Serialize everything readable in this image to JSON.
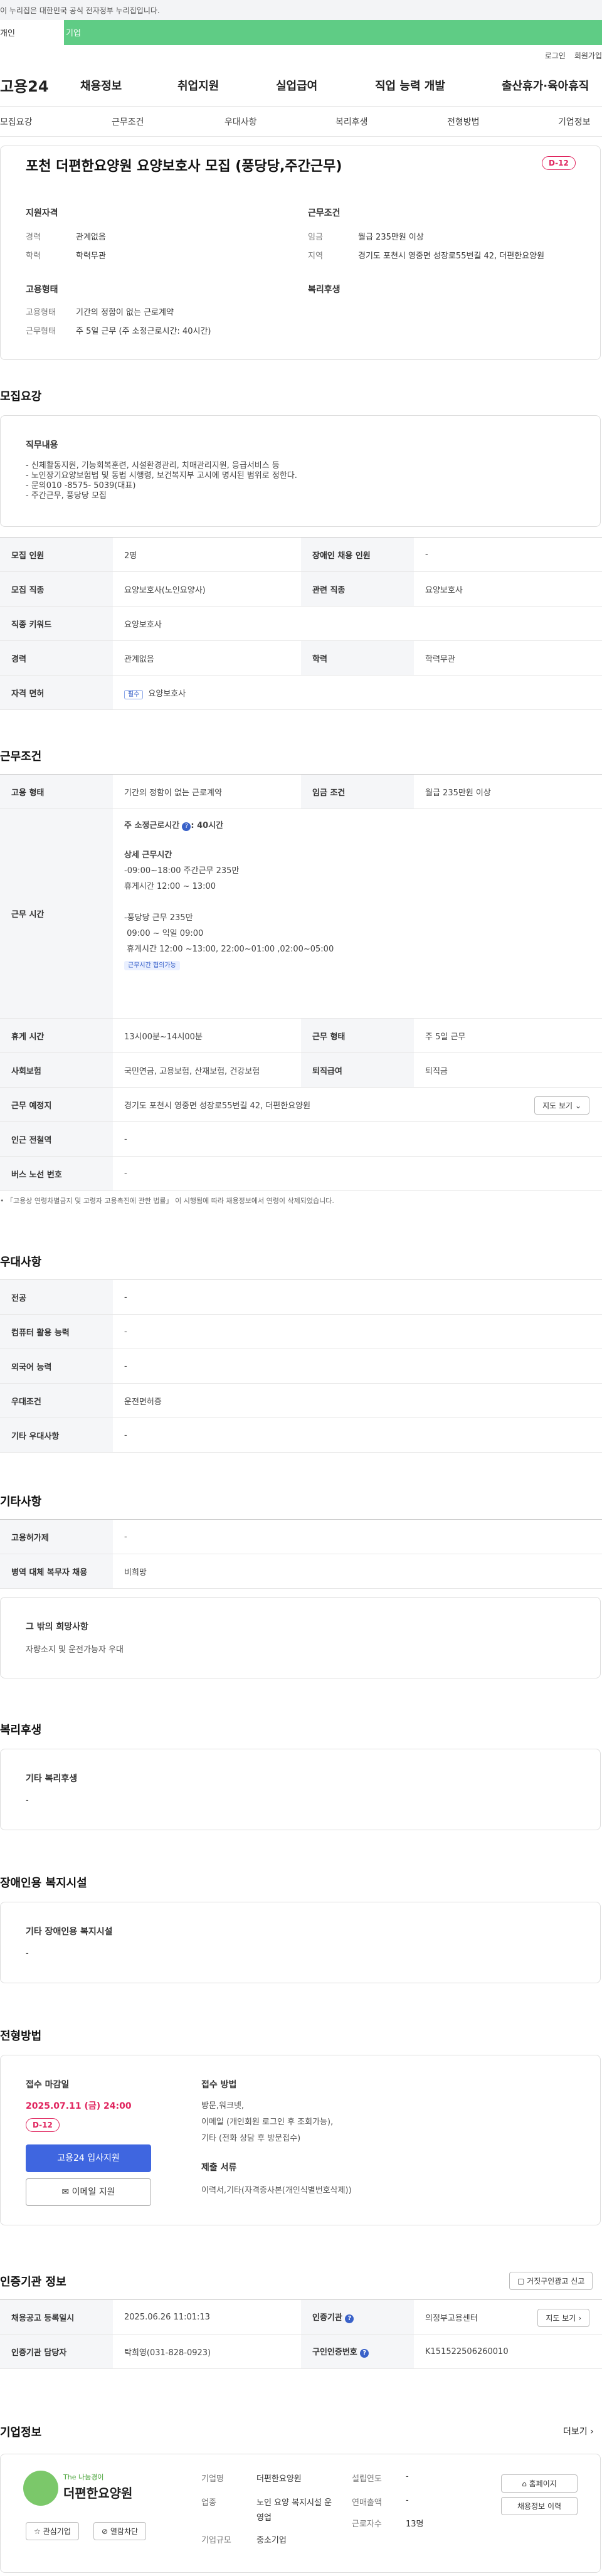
{
  "gov_bar": "이 누리집은 대한민국 공식 전자정부 누리집입니다.",
  "top_tabs": [
    "개인",
    "기업"
  ],
  "util_links": [
    "로그인",
    "회원가입"
  ],
  "logo": "고용24",
  "gnb": [
    "채용정보",
    "취업지원",
    "실업급여",
    "직업 능력 개발",
    "출산휴가·육아휴직"
  ],
  "anchor_tabs": [
    "모집요강",
    "근무조건",
    "우대사항",
    "복리후생",
    "전형방법",
    "기업정보"
  ],
  "job": {
    "title": "포천 더편한요양원 요양보호사 모집 (풍당당,주간근무)",
    "dday": "D-12",
    "summary": {
      "qual_title": "지원자격",
      "qual": [
        {
          "k": "경력",
          "v": "관계없음"
        },
        {
          "k": "학력",
          "v": "학력무관"
        }
      ],
      "cond_title": "근무조건",
      "cond": [
        {
          "k": "임금",
          "v": "월급 235만원 이상"
        },
        {
          "k": "지역",
          "v": "경기도 포천시 영중면 성장로55번길 42, 더편한요양원"
        }
      ],
      "type_title": "고용형태",
      "type": [
        {
          "k": "고용형태",
          "v": "기간의 정함이 없는 근로계약"
        },
        {
          "k": "근무형태",
          "v": "주 5일 근무 (주 소정근로시간: 40시간)"
        }
      ],
      "welfare_title": "복리후생"
    }
  },
  "recruit": {
    "title": "모집요강",
    "duty_title": "직무내용",
    "duty_lines": [
      "- 신체활동지원, 기능회복훈련, 시설환경관리, 치매관리지원, 응급서비스 등",
      "- 노인장기요양보험법 및 동법 시행령, 보건복지부 고시에 명시된 범위로 정한다.",
      "- 문의010 -8575- 5039(대표)",
      "- 주간근무, 풍당당 모집"
    ],
    "rows": [
      {
        "k1": "모집 인원",
        "v1": "2명",
        "k2": "장애인 채용 인원",
        "v2": "-"
      },
      {
        "k1": "모집 직종",
        "v1": "요양보호사(노인요양사)",
        "k2": "관련 직종",
        "v2": "요양보호사"
      },
      {
        "k1": "직종 키워드",
        "v1": "요양보호사"
      },
      {
        "k1": "경력",
        "v1": "관계없음",
        "k2": "학력",
        "v2": "학력무관"
      },
      {
        "k1": "자격 면허",
        "tag": "필수",
        "v1": "요양보호사"
      }
    ]
  },
  "work": {
    "title": "근무조건",
    "emp_type_k": "고용 형태",
    "emp_type_v": "기간의 정함이 없는 근로계약",
    "wage_k": "임금 조건",
    "wage_v": "월급 235만원 이상",
    "hours_k": "근무 시간",
    "hours_main": "주 소정근로시간",
    "hours_value": ": 40시간",
    "hours_detail_title": "상세 근무시간",
    "hours_lines": [
      "-09:00~18:00  주간근무 235만",
      "휴게시간 12:00 ~ 13:00",
      "",
      "-풍당당 근무 235만",
      " 09:00 ~ 익일 09:00",
      " 휴게시간 12:00 ~13:00, 22:00~01:00 ,02:00~05:00"
    ],
    "hours_tag": "근무시간 협의가능",
    "rest_k": "휴게 시간",
    "rest_v": "13시00분~14시00분",
    "form_k": "근무 형태",
    "form_v": "주 5일 근무",
    "ins_k": "사회보험",
    "ins_v": "국민연금, 고용보험, 산재보험, 건강보험",
    "sev_k": "퇴직급여",
    "sev_v": "퇴직금",
    "place_k": "근무 예정지",
    "place_v": "경기도 포천시 영중면 성장로55번길 42, 더편한요양원",
    "map_btn": "지도 보기",
    "subway_k": "인근 전철역",
    "subway_v": "-",
    "bus_k": "버스 노선 번호",
    "bus_v": "-",
    "note": "「고용상 연령차별금지 및 고령자 고용촉진에 관한 법률」 이 시행됨에 따라 채용정보에서 연령이 삭제되었습니다."
  },
  "pref": {
    "title": "우대사항",
    "rows": [
      {
        "k": "전공",
        "v": "-"
      },
      {
        "k": "컴퓨터 활용 능력",
        "v": "-"
      },
      {
        "k": "외국어 능력",
        "v": "-"
      },
      {
        "k": "우대조건",
        "v": "운전면허증"
      },
      {
        "k": "기타 우대사항",
        "v": "-"
      }
    ]
  },
  "other": {
    "title": "기타사항",
    "rows": [
      {
        "k": "고용허가제",
        "v": "-"
      },
      {
        "k": "병역 대체 복무자 채용",
        "v": "비희망"
      }
    ],
    "wish_title": "그 밖의 희망사항",
    "wish_v": "자량소지 및 운전가능자 우대"
  },
  "welfare": {
    "title": "복리후생",
    "sub": "기타 복리후생",
    "v": "-"
  },
  "disability": {
    "title": "장애인용 복지시설",
    "sub": "기타 장애인용 복지시설",
    "v": "-"
  },
  "selection": {
    "title": "전형방법",
    "deadline_k": "접수 마감일",
    "deadline_v": "2025.07.11 (금) 24:00",
    "dday": "D-12",
    "apply_btn": "고용24 입사지원",
    "email_btn": "이메일 지원",
    "method_k": "접수 방법",
    "method_lines": [
      "방문,워크넷,",
      "이메일 (개인회원 로그인 후 조회가능),",
      "기타 (전화 상담 후 방문접수)"
    ],
    "docs_k": "제출 서류",
    "docs_v": "이력서,기타(자격증사본(개인식별번호삭제))"
  },
  "agency": {
    "title": "인증기관 정보",
    "report_btn": "거짓구인광고 신고",
    "r1": {
      "k1": "채용공고 등록일시",
      "v1": "2025.06.26 11:01:13",
      "k2": "인증기관",
      "v2": "의정부고용센터",
      "btn": "지도 보기"
    },
    "r2": {
      "k1": "인증기관 담당자",
      "v1": "탁희영(031-828-0923)",
      "k2": "구인인증번호",
      "v2": "K151522506260010"
    }
  },
  "company": {
    "title": "기업정보",
    "more": "더보기",
    "logo_small": "The 나눔경이",
    "logo_name": "더편한요양원",
    "fav_btn": "관심기업",
    "block_btn": "열람차단",
    "k_name": "기업명",
    "v_name": "더편한요양원",
    "k_biz": "업종",
    "v_biz": "노인 요양 복지시설 운영업",
    "k_size": "기업규모",
    "v_size": "중소기업",
    "k_year": "설립연도",
    "v_year": "-",
    "k_sales": "연매출액",
    "v_sales": "-",
    "k_emp": "근로자수",
    "v_emp": "13명",
    "home_btn": "홈페이지",
    "jobs_btn": "채용정보 이력"
  }
}
